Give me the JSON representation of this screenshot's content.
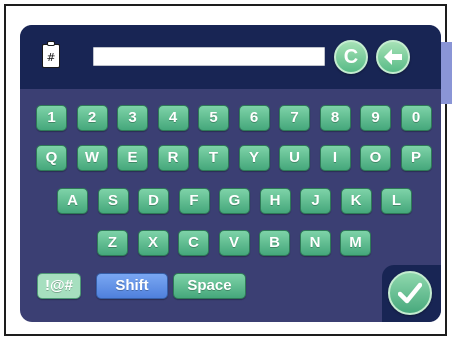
{
  "toolbar": {
    "clipboard_symbol": "#",
    "input_value": "",
    "clear_label": "C",
    "backspace_icon": "left-arrow-icon"
  },
  "keys": {
    "row1": [
      "1",
      "2",
      "3",
      "4",
      "5",
      "6",
      "7",
      "8",
      "9",
      "0"
    ],
    "row2": [
      "Q",
      "W",
      "E",
      "R",
      "T",
      "Y",
      "U",
      "I",
      "O",
      "P"
    ],
    "row3": [
      "A",
      "S",
      "D",
      "F",
      "G",
      "H",
      "J",
      "K",
      "L"
    ],
    "row4": [
      "Z",
      "X",
      "C",
      "V",
      "B",
      "N",
      "M"
    ],
    "symbols_label": "!@#",
    "shift_label": "Shift",
    "space_label": "Space",
    "done_icon": "checkmark-icon"
  },
  "colors": {
    "keyboard_bg": "#3b3f73",
    "toolbar_bg": "#182554",
    "key_green": "#5bbf8d",
    "shift_blue": "#5f8fe6"
  }
}
